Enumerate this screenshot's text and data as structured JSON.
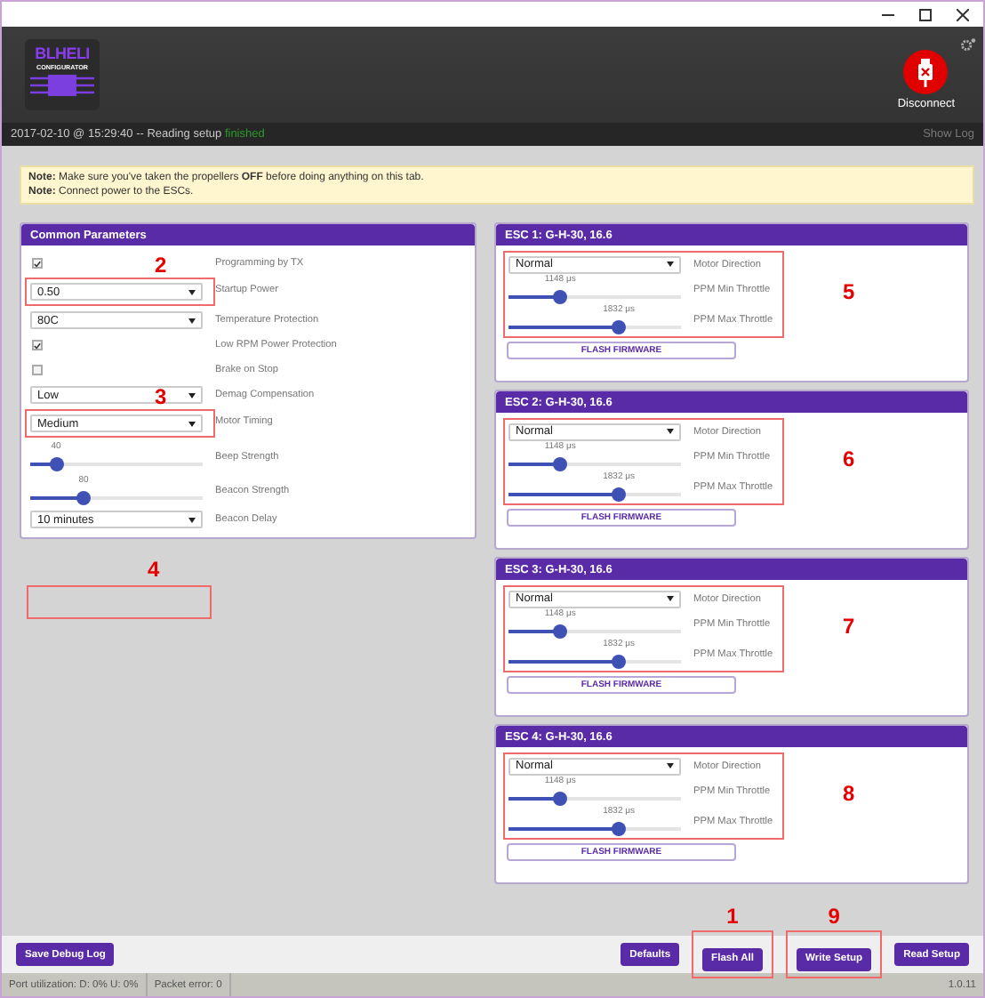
{
  "header": {
    "logo": {
      "title": "BLHELI",
      "subtitle": "CONFIGURATOR"
    },
    "connect_button": {
      "label": "Disconnect"
    }
  },
  "status_line": {
    "message": "2017-02-10 @ 15:29:40 -- Reading setup",
    "result": "finished",
    "show_log": "Show Log"
  },
  "notes": [
    {
      "label": "Note:",
      "text": "Make sure you've taken the propellers **OFF** before doing anything on this tab."
    },
    {
      "label": "Note:",
      "text": "Connect power to the ESCs."
    }
  ],
  "common_parameters": {
    "title": "Common Parameters",
    "rows": [
      {
        "kind": "checkbox",
        "label": "Programming by TX",
        "checked": true
      },
      {
        "kind": "select",
        "label": "Startup Power",
        "value": "0.50",
        "annotation": "2"
      },
      {
        "kind": "select",
        "label": "Temperature Protection",
        "value": "80C"
      },
      {
        "kind": "checkbox",
        "label": "Low RPM Power Protection",
        "checked": true
      },
      {
        "kind": "checkbox",
        "label": "Brake on Stop",
        "checked": false
      },
      {
        "kind": "select",
        "label": "Demag Compensation",
        "value": "Low"
      },
      {
        "kind": "select",
        "label": "Motor Timing",
        "value": "Medium",
        "annotation": "3"
      },
      {
        "kind": "slider",
        "label": "Beep Strength",
        "reading": "40",
        "level": 0.15
      },
      {
        "kind": "slider",
        "label": "Beacon Strength",
        "reading": "80",
        "level": 0.31
      },
      {
        "kind": "select",
        "label": "Beacon Delay",
        "value": "10 minutes"
      }
    ]
  },
  "empty_annotation": {
    "number": "4"
  },
  "escs": [
    {
      "title": "ESC 1: G-H-30, 16.6",
      "direction": {
        "value": "Normal",
        "label": "Motor Direction"
      },
      "min_throttle": {
        "reading": "1148 μs",
        "level": 0.3,
        "label": "PPM Min Throttle"
      },
      "max_throttle": {
        "reading": "1832 μs",
        "level": 0.64,
        "label": "PPM Max Throttle"
      },
      "flash_button": "FLASH FIRMWARE",
      "annotation": "5"
    },
    {
      "title": "ESC 2: G-H-30, 16.6",
      "direction": {
        "value": "Normal",
        "label": "Motor Direction"
      },
      "min_throttle": {
        "reading": "1148 μs",
        "level": 0.3,
        "label": "PPM Min Throttle"
      },
      "max_throttle": {
        "reading": "1832 μs",
        "level": 0.64,
        "label": "PPM Max Throttle"
      },
      "flash_button": "FLASH FIRMWARE",
      "annotation": "6"
    },
    {
      "title": "ESC 3: G-H-30, 16.6",
      "direction": {
        "value": "Normal",
        "label": "Motor Direction"
      },
      "min_throttle": {
        "reading": "1148 μs",
        "level": 0.3,
        "label": "PPM Min Throttle"
      },
      "max_throttle": {
        "reading": "1832 μs",
        "level": 0.64,
        "label": "PPM Max Throttle"
      },
      "flash_button": "FLASH FIRMWARE",
      "annotation": "7"
    },
    {
      "title": "ESC 4: G-H-30, 16.6",
      "direction": {
        "value": "Normal",
        "label": "Motor Direction"
      },
      "min_throttle": {
        "reading": "1148 μs",
        "level": 0.3,
        "label": "PPM Min Throttle"
      },
      "max_throttle": {
        "reading": "1832 μs",
        "level": 0.64,
        "label": "PPM Max Throttle"
      },
      "flash_button": "FLASH FIRMWARE",
      "annotation": "8"
    }
  ],
  "footer": {
    "left_button": "Save Debug Log",
    "buttons": [
      {
        "label": "Defaults"
      },
      {
        "label": "Flash All",
        "annotation": "1"
      },
      {
        "label": "Write Setup",
        "annotation": "9"
      },
      {
        "label": "Read Setup"
      }
    ]
  },
  "status_bar": {
    "port_utilization": "Port utilization: D: 0% U: 0%",
    "packet_error": "Packet error: 0",
    "version": "1.0.11"
  }
}
